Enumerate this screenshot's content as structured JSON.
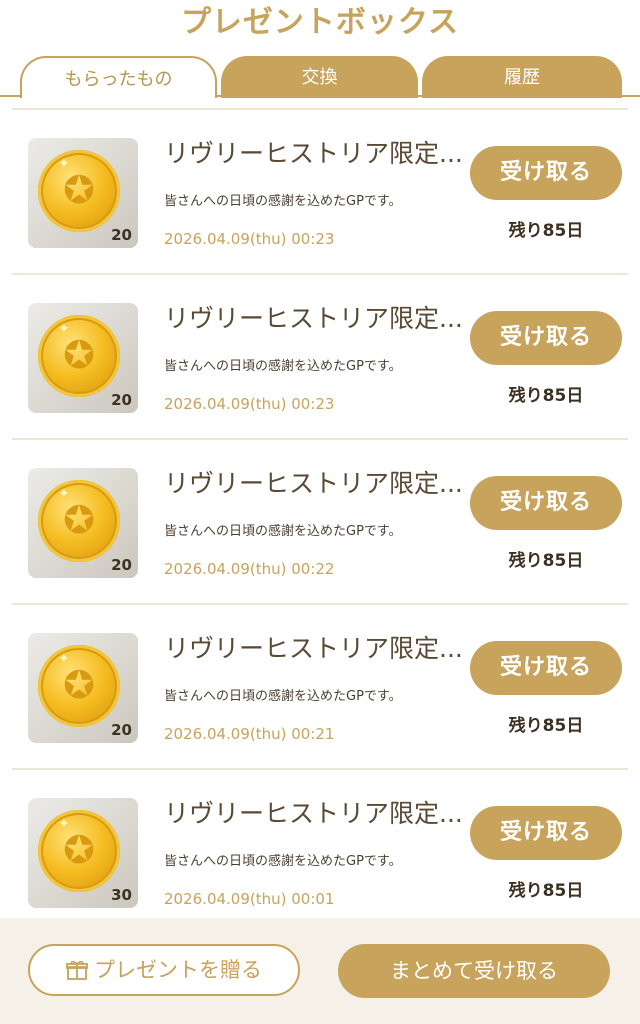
{
  "header": {
    "title": "プレゼントボックス"
  },
  "tabs": [
    {
      "label": "もらったもの",
      "active": true
    },
    {
      "label": "交換",
      "active": false
    },
    {
      "label": "履歴",
      "active": false
    }
  ],
  "items": [
    {
      "title": "リヴリーヒストリア限定...",
      "description": "皆さんへの日頃の感謝を込めたGPです。",
      "date": "2026.04.09(thu) 00:23",
      "quantity": "20",
      "button": "受け取る",
      "remaining": "残り85日",
      "icon": "gold-coin-icon"
    },
    {
      "title": "リヴリーヒストリア限定...",
      "description": "皆さんへの日頃の感謝を込めたGPです。",
      "date": "2026.04.09(thu) 00:23",
      "quantity": "20",
      "button": "受け取る",
      "remaining": "残り85日",
      "icon": "gold-coin-icon"
    },
    {
      "title": "リヴリーヒストリア限定...",
      "description": "皆さんへの日頃の感謝を込めたGPです。",
      "date": "2026.04.09(thu) 00:22",
      "quantity": "20",
      "button": "受け取る",
      "remaining": "残り85日",
      "icon": "gold-coin-icon"
    },
    {
      "title": "リヴリーヒストリア限定...",
      "description": "皆さんへの日頃の感謝を込めたGPです。",
      "date": "2026.04.09(thu) 00:21",
      "quantity": "20",
      "button": "受け取る",
      "remaining": "残り85日",
      "icon": "gold-coin-icon"
    },
    {
      "title": "リヴリーヒストリア限定...",
      "description": "皆さんへの日頃の感謝を込めたGPです。",
      "date": "2026.04.09(thu) 00:01",
      "quantity": "30",
      "button": "受け取る",
      "remaining": "残り85日",
      "icon": "gold-coin-icon"
    }
  ],
  "footer": {
    "gift_label": "プレゼントを贈る",
    "bulk_label": "まとめて受け取る"
  },
  "colors": {
    "accent": "#c7a35c",
    "text": "#3d3121",
    "footer_bg": "#f5f1e9"
  }
}
